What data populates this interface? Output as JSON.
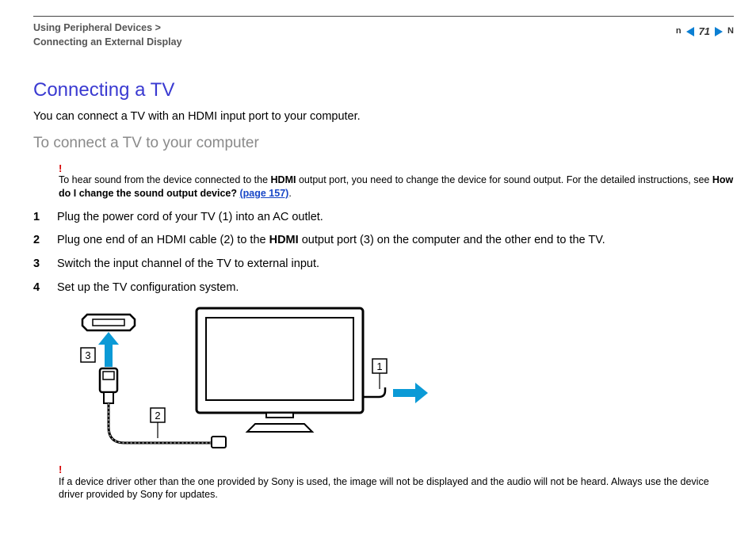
{
  "breadcrumb": {
    "line1": "Using Peripheral Devices",
    "sep": ">",
    "line2": "Connecting an External Display"
  },
  "pager": {
    "n_label": "n",
    "page_number": "71",
    "N_label": "N"
  },
  "title": "Connecting a TV",
  "intro": "You can connect a TV with an HDMI input port to your computer.",
  "subhead": "To connect a TV to your computer",
  "note1": {
    "bang": "!",
    "text_a": "To hear sound from the device connected to the ",
    "hdmi": "HDMI",
    "text_b": " output port, you need to change the device for sound output. For the detailed instructions, see ",
    "bold_q": "How do I change the sound output device?",
    "link": "(page 157)",
    "dot": "."
  },
  "steps": {
    "s1_num": "1",
    "s1": "Plug the power cord of your TV (1) into an AC outlet.",
    "s2_num": "2",
    "s2_a": "Plug one end of an HDMI cable (2) to the ",
    "s2_hdmi": "HDMI",
    "s2_b": " output port (3) on the computer and the other end to the TV.",
    "s3_num": "3",
    "s3": "Switch the input channel of the TV to external input.",
    "s4_num": "4",
    "s4": "Set up the TV configuration system."
  },
  "diagram_labels": {
    "l1": "1",
    "l2": "2",
    "l3": "3"
  },
  "note2": {
    "bang": "!",
    "text": "If a device driver other than the one provided by Sony is used, the image will not be displayed and the audio will not be heard. Always use the device driver provided by Sony for updates."
  }
}
